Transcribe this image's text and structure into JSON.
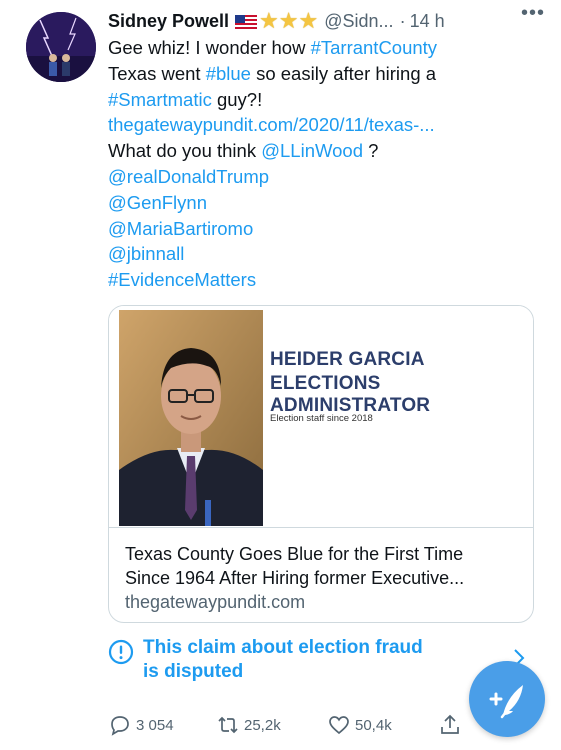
{
  "tweet": {
    "author_name": "Sidney Powell",
    "author_handle": "@Sidn...",
    "separator": "·",
    "time": "14 h",
    "more_icon": "more-horizontal-icon",
    "emoji": [
      "flag-us",
      "star",
      "star",
      "star"
    ],
    "body": {
      "line1_text": "Gee whiz! I wonder how ",
      "line1_link": "#TarrantCounty",
      "line2_text_a": "Texas went ",
      "line2_link": "#blue",
      "line2_text_b": " so easily after hiring a",
      "line3_link": "#Smartmatic",
      "line3_text": " guy?!",
      "line4_link": "thegatewaypundit.com/2020/11/texas-...",
      "line5_text_a": "What do you think ",
      "line5_link": "@LLinWood",
      "line5_text_b": " ?",
      "mentions": [
        "@realDonaldTrump",
        "@GenFlynn",
        "@MariaBartiromo",
        "@jbinnall",
        "#EvidenceMatters"
      ]
    }
  },
  "card": {
    "image_title_1": "HEIDER GARCIA",
    "image_title_2": "ELECTIONS ADMINISTRATOR",
    "image_subtitle": "Election staff since 2018",
    "headline_line1": "Texas County Goes Blue for the First Time",
    "headline_line2": "Since 1964 After Hiring former Executive...",
    "domain": "thegatewaypundit.com"
  },
  "notice": {
    "icon": "exclamation-circle-icon",
    "line1": "This claim about election fraud",
    "line2": "is disputed"
  },
  "actions": {
    "replies": "3 054",
    "retweets": "25,2k",
    "likes": "50,4k"
  },
  "colors": {
    "link": "#1d9bf0",
    "fab": "#4a9ee8",
    "secondary_text": "#536471"
  }
}
